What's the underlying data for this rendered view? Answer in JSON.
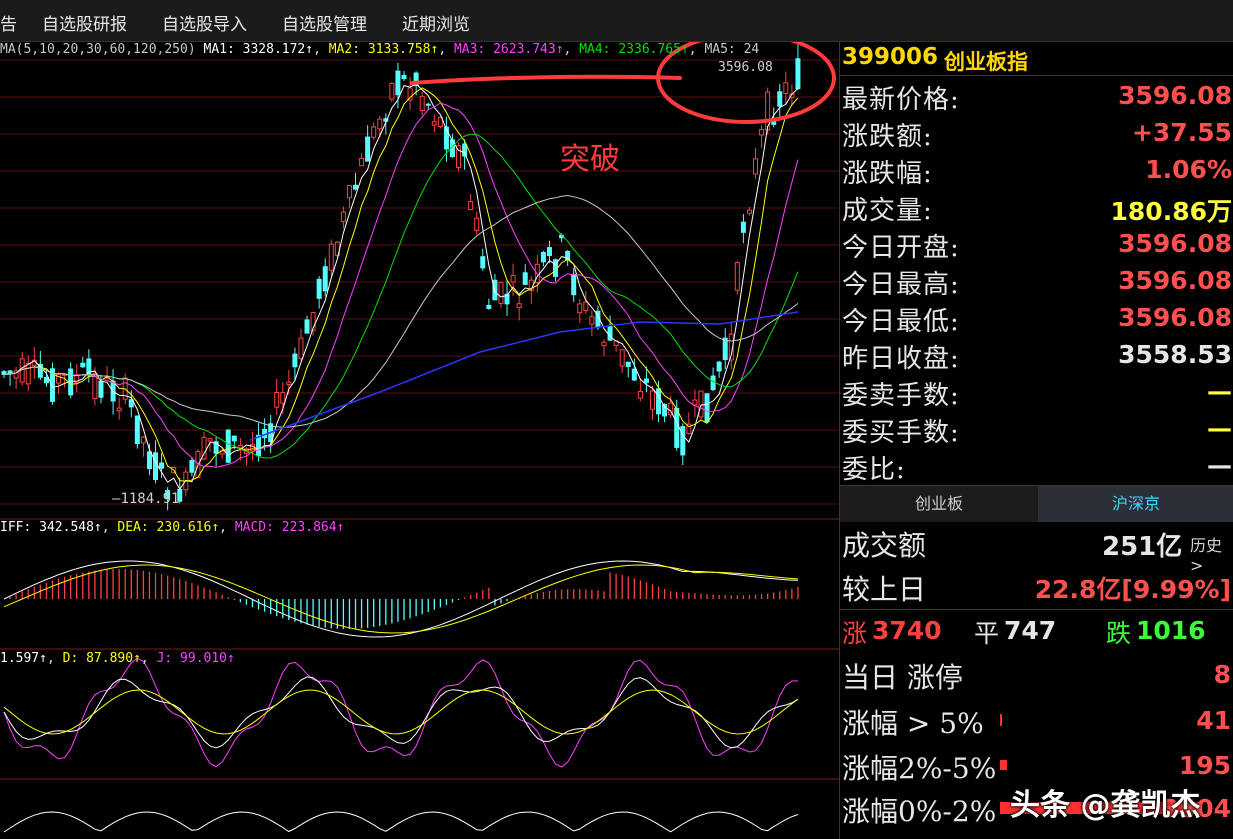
{
  "menu": {
    "items": [
      "告",
      "自选股研报",
      "自选股导入",
      "自选股管理",
      "近期浏览"
    ]
  },
  "chart": {
    "ma_legend": {
      "params": "MA(5,10,20,30,60,120,250)",
      "ma1": "MA1: 3328.172↑",
      "ma2": "MA2: 3133.758↑",
      "ma3": "MA3: 2623.743↑",
      "ma4": "MA4: 2336.765↑",
      "ma5": "MA5: 24"
    },
    "high_label": "3596.08",
    "low_label": "1184.91",
    "annotation": "突破",
    "macd_legend": {
      "diff": "IFF: 342.548↑",
      "dea": "DEA: 230.616↑",
      "macd": "MACD: 223.864↑"
    },
    "kdj_legend": {
      "k": "1.597↑",
      "d": "D: 87.890↑",
      "j": "J: 99.010↑"
    },
    "colors": {
      "up": "#ff4040",
      "down": "#54ffff",
      "ma1": "#ffffff",
      "ma2": "#ffff00",
      "ma3": "#ff40ff",
      "ma4": "#00e000",
      "ma5": "#c8c8c8",
      "ma6": "#2b35ff"
    }
  },
  "quote": {
    "code": "399006",
    "name": "创业板指",
    "rows": [
      {
        "label": "最新价格:",
        "value": "3596.08",
        "color": "#ff5050"
      },
      {
        "label": "涨跌额:",
        "value": "+37.55",
        "color": "#ff5050"
      },
      {
        "label": "涨跌幅:",
        "value": "1.06%",
        "color": "#ff5050"
      },
      {
        "label": "成交量:",
        "value": "180.86万",
        "color": "#ffff40"
      },
      {
        "label": "今日开盘:",
        "value": "3596.08",
        "color": "#ff5050"
      },
      {
        "label": "今日最高:",
        "value": "3596.08",
        "color": "#ff5050"
      },
      {
        "label": "今日最低:",
        "value": "3596.08",
        "color": "#ff5050"
      },
      {
        "label": "昨日收盘:",
        "value": "3558.53",
        "color": "#e6e6e6"
      },
      {
        "label": "委卖手数:",
        "value": "—",
        "color": "#ffff40"
      },
      {
        "label": "委买手数:",
        "value": "—",
        "color": "#ffff40"
      },
      {
        "label": "委比:",
        "value": "—",
        "color": "#e6e6e6"
      }
    ],
    "tabs": [
      "创业板",
      "沪深京"
    ],
    "turnover_label": "成交额",
    "turnover_value": "251亿",
    "history_link": "历史>",
    "vs_label": "较上日",
    "vs_value": "22.8亿[9.99%]",
    "up_label": "涨",
    "up_count": "3740",
    "flat_label": "平",
    "flat_count": "747",
    "down_label": "跌",
    "down_count": "1016",
    "limit_label": "当日 涨停",
    "limit_value": "8",
    "gt5_label": "涨幅 > 5%",
    "gt5_value": "41",
    "r25_label": "涨幅2%-5%",
    "r25_value": "195",
    "r02_label": "涨幅0%-2%",
    "r02_value": "3504"
  },
  "watermark": "头条 @龚凯杰"
}
